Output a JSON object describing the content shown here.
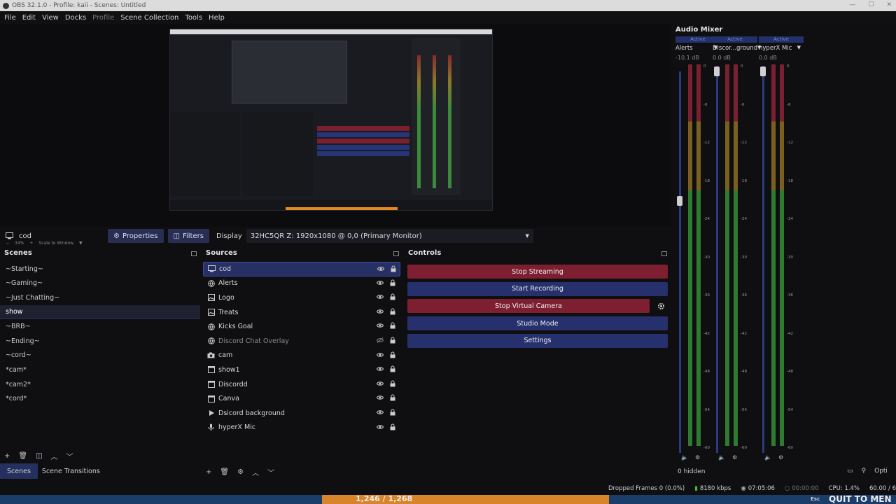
{
  "window": {
    "title": "OBS 32.1.0 - Profile: kaii - Scenes: Untitled",
    "controls": [
      "—",
      "☐",
      "✕"
    ]
  },
  "menu": [
    "File",
    "Edit",
    "View",
    "Docks",
    "Profile",
    "Scene Collection",
    "Tools",
    "Help"
  ],
  "preview": {
    "zoom": "34%",
    "scale_mode": "Scale to Window"
  },
  "source_toolbar": {
    "selected_source": "cod",
    "properties_label": "Properties",
    "filters_label": "Filters",
    "display_label": "Display",
    "display_value": "32HC5QR Z: 1920x1080 @ 0,0 (Primary Monitor)"
  },
  "scenes": {
    "title": "Scenes",
    "items": [
      "~Starting~",
      "~Gaming~",
      "~Just Chatting~",
      "show",
      "~BRB~",
      "~Ending~",
      "~cord~",
      "*cam*",
      "*cam2*",
      "*cord*"
    ],
    "selected": "show"
  },
  "sources": {
    "title": "Sources",
    "items": [
      {
        "name": "cod",
        "icon": "monitor-icon",
        "selected": true,
        "visible": true
      },
      {
        "name": "Alerts",
        "icon": "globe-icon",
        "visible": true
      },
      {
        "name": "Logo",
        "icon": "image-icon",
        "visible": true
      },
      {
        "name": "Treats",
        "icon": "image-icon",
        "visible": true
      },
      {
        "name": "Kicks Goal",
        "icon": "globe-icon",
        "visible": true
      },
      {
        "name": "Discord Chat Overlay",
        "icon": "globe-icon",
        "visible": false
      },
      {
        "name": "cam",
        "icon": "camera-icon",
        "visible": true
      },
      {
        "name": "show1",
        "icon": "window-icon",
        "visible": true
      },
      {
        "name": "Discordd",
        "icon": "window-icon",
        "visible": true
      },
      {
        "name": "Canva",
        "icon": "window-icon",
        "visible": true
      },
      {
        "name": "Dsicord background",
        "icon": "play-icon",
        "visible": true
      },
      {
        "name": "hyperX Mic",
        "icon": "mic-icon",
        "visible": true
      }
    ]
  },
  "controls": {
    "title": "Controls",
    "stop_streaming": "Stop Streaming",
    "start_recording": "Start Recording",
    "stop_virtual_camera": "Stop Virtual Camera",
    "studio_mode": "Studio Mode",
    "settings": "Settings"
  },
  "dock_tabs": [
    "Scenes",
    "Scene Transitions"
  ],
  "audio_mixer": {
    "title": "Audio Mixer",
    "channels": [
      {
        "name": "Alerts",
        "status": "Active",
        "db": "-10.1 dB"
      },
      {
        "name": "Discor...ground",
        "status": "Active",
        "db": "0.0 dB"
      },
      {
        "name": "hyperX Mic",
        "status": "Active",
        "db": "0.0 dB"
      }
    ],
    "scale": [
      "0",
      "-6",
      "-12",
      "-18",
      "-24",
      "-30",
      "-36",
      "-42",
      "-48",
      "-54",
      "-60"
    ],
    "hidden": "0 hidden",
    "options_label": "Opti"
  },
  "status": {
    "dropped_frames": "Dropped Frames 0 (0.0%)",
    "bitrate": "8180 kbps",
    "stream_time": "07:05:06",
    "rec_time": "00:00:00",
    "cpu": "CPU: 1.4%",
    "fps": "60.00 / 6"
  },
  "stream_strip": {
    "counter": "1,246 / 1,268",
    "banner": "QUIT TO MEN",
    "key_hint": "Esc"
  },
  "colors": {
    "red": "#7d1f30",
    "blue": "#26306c",
    "accent": "#3d4aa0"
  }
}
